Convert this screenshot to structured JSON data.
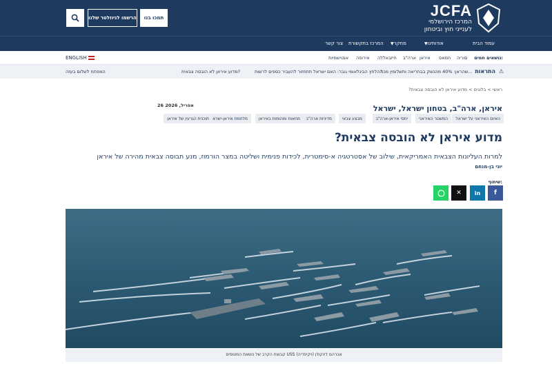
{
  "header": {
    "logo_title": "JCFA",
    "logo_line1": "המרכז הירושלמי",
    "logo_line2": "לענייני חוץ וביטחון",
    "donate_label": "תמכו בנו",
    "newsletter_label": "הרשמו לניוזלטר שלנו"
  },
  "nav": {
    "items": [
      "עמוד הבית",
      "אודותינו",
      "מחקר",
      "המרכז בתקשורת",
      "צור קשר"
    ]
  },
  "topics": {
    "label": "נושאים חמים:",
    "items": [
      "סוריה",
      "חמאס",
      "איראן",
      "ארה\"ב",
      "חיזבאללה",
      "אירופה",
      "אנטישמיות"
    ],
    "language": "ENGLISH"
  },
  "alerts": {
    "title": "התראות",
    "items": [
      "שהראן: 40% מהנשק בבחריאה ותשלומין מכה...",
      "הלחץ הבינלאומי גובר: האם ישראל תתחזור להעביר כספים לרשות?",
      "מדוע איראן לא הובסה צבאית?",
      "המפתח לשלום בעזה"
    ]
  },
  "breadcrumb": "ראשי > בלוגים > מדוע איראן לא הובסה צבאית?",
  "article": {
    "date": "26 אפריל, 2026",
    "categories": "איראן, ארה\"ב, בטחון ישראל, ישראל",
    "tags": [
      "האיום האיראני על ישראל",
      "המשטר האיראני",
      "יחסי איראן-ארה\"ב",
      "מבצע צבאי",
      "מדיניות ארה\"ב",
      "מחאות ומהומות באיראן",
      "מלחמת איראן-ישראל",
      "תוכנית הגרעין של איראן"
    ],
    "title": "מדוע איראן לא הובסה צבאית?",
    "lead": "למרות העליונות הצבאית האמריקאית, שילוב של אסטרטגיה א-סימטרית, לכידות פנימית ושליטה במצר הורמוז, מנע תבוסה צבאית מהירה של איראן",
    "author": "יוני בן-מנחם",
    "share_label": "שיתוף:",
    "caption": "קבוצת הקרב של נושאת המטוסים USS אברהם לינקולן (ויקיפדיה)"
  },
  "icons": {
    "search": "search-icon",
    "facebook": "facebook-icon",
    "linkedin": "linkedin-icon",
    "x": "x-icon",
    "whatsapp": "whatsapp-icon",
    "alert": "warning-icon",
    "flag": "us-flag-icon"
  },
  "colors": {
    "brand_navy": "#1e3a5f",
    "facebook": "#3b5998",
    "linkedin": "#0e76a8",
    "whatsapp": "#25d366"
  }
}
